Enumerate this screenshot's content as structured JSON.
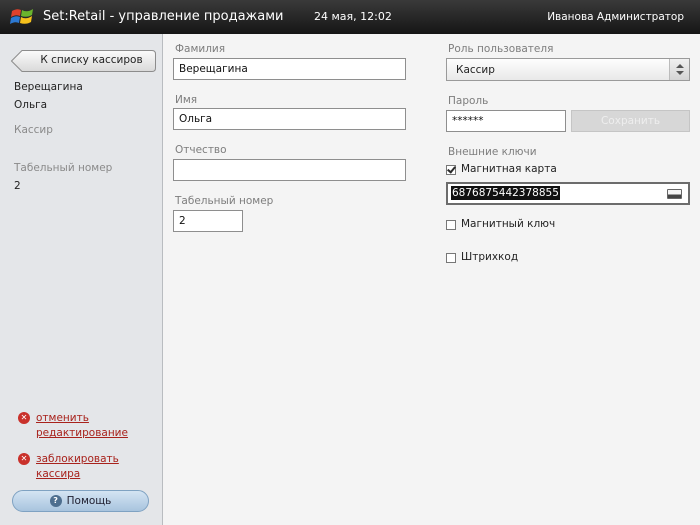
{
  "header": {
    "title": "Set:Retail - управление продажами",
    "datetime": "24 мая, 12:02",
    "user": "Иванова  Администратор"
  },
  "sidebar": {
    "back_label": "К списку кассиров",
    "last_name": "Верещагина",
    "first_name": "Ольга",
    "role": "Кассир",
    "tabel_label": "Табельный номер",
    "tabel_value": "2",
    "cancel_edit_line1": "отменить",
    "cancel_edit_line2": "редактирование",
    "block_label": "заблокировать кассира",
    "help_label": "Помощь"
  },
  "form": {
    "last_name_label": "Фамилия",
    "last_name_value": "Верещагина",
    "first_name_label": "Имя",
    "first_name_value": "Ольга",
    "middle_name_label": "Отчество",
    "middle_name_value": "",
    "tabel_label": "Табельный номер",
    "tabel_value": "2",
    "role_label": "Роль пользователя",
    "role_value": "Кассир",
    "password_label": "Пароль",
    "password_value": "******",
    "save_label": "Сохранить",
    "ext_keys_label": "Внешние ключи",
    "mag_card_label": "Магнитная карта",
    "mag_card_checked": true,
    "mag_card_value": "6876875442378855",
    "mag_key_label": "Магнитный ключ",
    "mag_key_checked": false,
    "barcode_label": "Штрихкод",
    "barcode_checked": false
  },
  "colors": {
    "header_bg": "#1f1f1f",
    "link_red": "#a8221c",
    "help_blue": "#a8c4de"
  }
}
